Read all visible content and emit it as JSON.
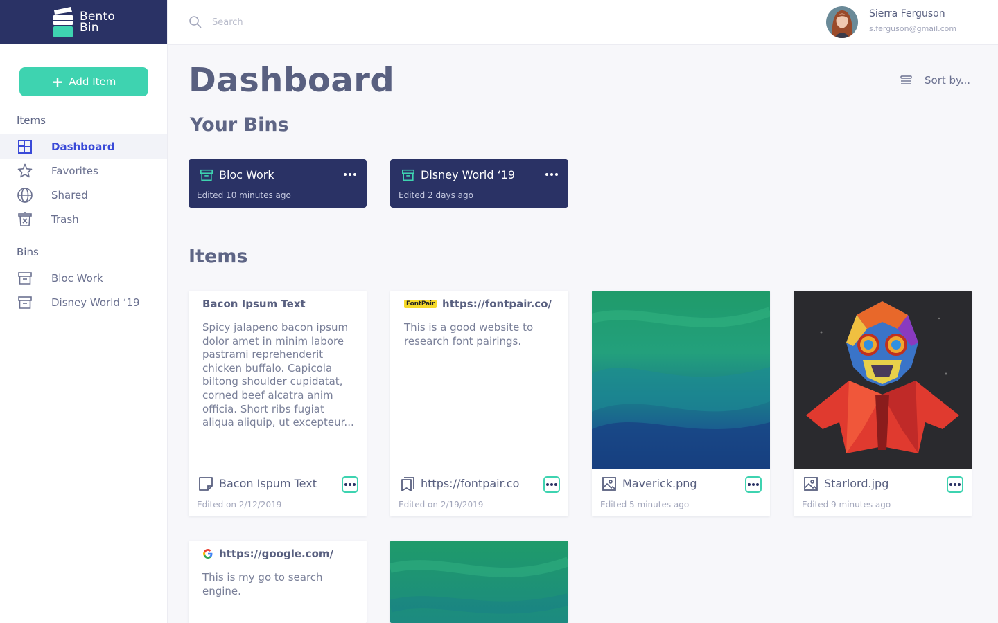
{
  "app": {
    "logo_line1": "Bento",
    "logo_line2": "Bin"
  },
  "sidebar": {
    "add_label": "Add Item",
    "items_header": "Items",
    "nav": [
      {
        "label": "Dashboard",
        "icon": "dashboard-icon"
      },
      {
        "label": "Favorites",
        "icon": "star-icon"
      },
      {
        "label": "Shared",
        "icon": "globe-icon"
      },
      {
        "label": "Trash",
        "icon": "trash-icon"
      }
    ],
    "bins_header": "Bins",
    "bins": [
      {
        "label": "Bloc Work",
        "icon": "archive-box-icon"
      },
      {
        "label": "Disney World ‘19",
        "icon": "archive-box-icon"
      }
    ]
  },
  "header": {
    "search_placeholder": "Search",
    "user_name": "Sierra Ferguson",
    "user_email": "s.ferguson@gmail.com"
  },
  "main": {
    "title": "Dashboard",
    "sort_label": "Sort by...",
    "bins_title": "Your Bins",
    "items_title": "Items"
  },
  "bins": [
    {
      "name": "Bloc Work",
      "edited": "Edited 10 minutes ago"
    },
    {
      "name": "Disney World ‘19",
      "edited": "Edited 2 days ago"
    }
  ],
  "items": [
    {
      "type": "note",
      "header": "Bacon Ipsum Text",
      "body": "Spicy jalapeno bacon ipsum dolor amet in minim labore pastrami reprehenderit chicken buffalo. Capicola biltong shoulder cupidatat, corned beef alcatra anim officia. Short ribs fugiat aliqua aliquip, ut excepteur...",
      "title": "Bacon Ispum Text",
      "edited": "Edited on 2/12/2019"
    },
    {
      "type": "link",
      "badge": "FontPair",
      "header": "https://fontpair.co/",
      "body": "This is a good website to research font pairings.",
      "title": "https://fontpair.co",
      "edited": "Edited on 2/19/2019"
    },
    {
      "type": "image",
      "title": "Maverick.png",
      "edited": "Edited 5 minutes ago"
    },
    {
      "type": "image",
      "title": "Starlord.jpg",
      "edited": "Edited 9 minutes ago"
    },
    {
      "type": "link",
      "header": "https://google.com/",
      "body": "This is my go to search engine."
    },
    {
      "type": "image"
    }
  ],
  "colors": {
    "navy": "#2a3265",
    "teal": "#3ed3b0",
    "active_blue": "#3a4ad8",
    "text": "#596080"
  }
}
